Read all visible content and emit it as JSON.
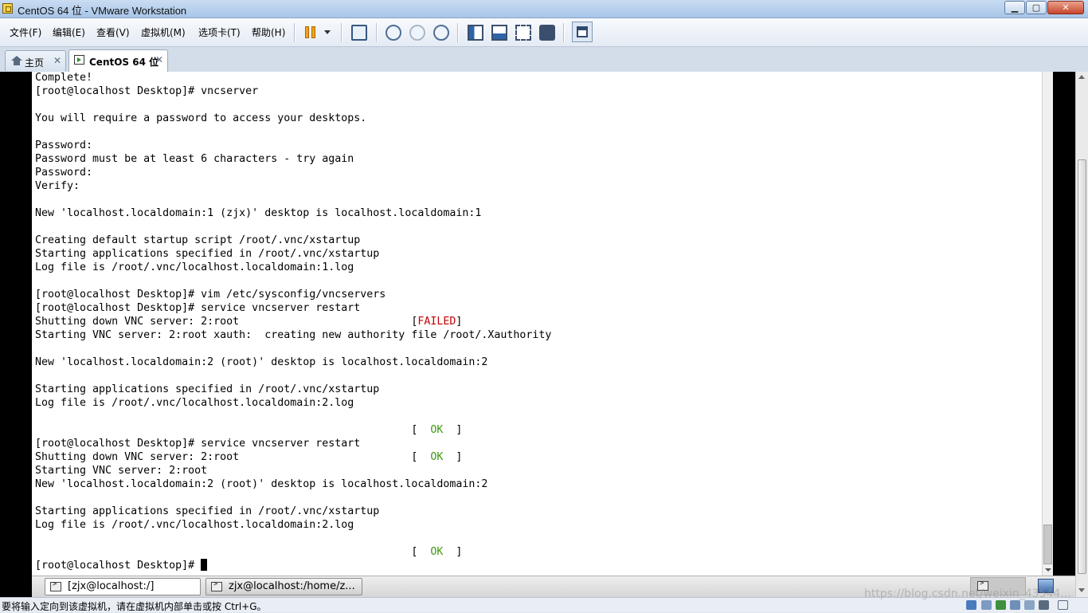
{
  "window": {
    "title": "CentOS 64 位 - VMware Workstation",
    "minimize_glyph": "▁",
    "maximize_glyph": "▢",
    "close_glyph": "✕"
  },
  "menu": {
    "items": [
      "文件(F)",
      "编辑(E)",
      "查看(V)",
      "虚拟机(M)",
      "选项卡(T)",
      "帮助(H)"
    ]
  },
  "toolbar": {
    "icons": [
      "pause-icon",
      "send-ctrl-alt-del-icon",
      "take-snapshot-icon",
      "revert-snapshot-icon",
      "snapshot-manager-icon",
      "console-view-icon",
      "full-screen-icon",
      "stretch-icon",
      "unity-icon",
      "library-icon"
    ],
    "accent_color": "#f0a020"
  },
  "tabs": [
    {
      "label": "主页",
      "close": "✕"
    },
    {
      "label": "CentOS 64 位",
      "close": "✕"
    }
  ],
  "terminal": {
    "lines": [
      {
        "text": "Complete!"
      },
      {
        "text": "[root@localhost Desktop]# vncserver"
      },
      {
        "text": ""
      },
      {
        "text": "You will require a password to access your desktops."
      },
      {
        "text": ""
      },
      {
        "text": "Password:"
      },
      {
        "text": "Password must be at least 6 characters - try again"
      },
      {
        "text": "Password:"
      },
      {
        "text": "Verify:"
      },
      {
        "text": ""
      },
      {
        "text": "New 'localhost.localdomain:1 (zjx)' desktop is localhost.localdomain:1"
      },
      {
        "text": ""
      },
      {
        "text": "Creating default startup script /root/.vnc/xstartup"
      },
      {
        "text": "Starting applications specified in /root/.vnc/xstartup"
      },
      {
        "text": "Log file is /root/.vnc/localhost.localdomain:1.log"
      },
      {
        "text": ""
      },
      {
        "text": "[root@localhost Desktop]# vim /etc/sysconfig/vncservers"
      },
      {
        "text": "[root@localhost Desktop]# service vncserver restart"
      },
      {
        "text": "Shutting down VNC server: 2:root                           ",
        "pre": "[",
        "status": "FAILED",
        "post": "]",
        "status_class": "st-failed"
      },
      {
        "text": "Starting VNC server: 2:root xauth:  creating new authority file /root/.Xauthority"
      },
      {
        "text": ""
      },
      {
        "text": "New 'localhost.localdomain:2 (root)' desktop is localhost.localdomain:2"
      },
      {
        "text": ""
      },
      {
        "text": "Starting applications specified in /root/.vnc/xstartup"
      },
      {
        "text": "Log file is /root/.vnc/localhost.localdomain:2.log"
      },
      {
        "text": ""
      },
      {
        "text": "                                                           ",
        "pre": "[  ",
        "status": "OK",
        "post": "  ]",
        "status_class": "st-ok"
      },
      {
        "text": "[root@localhost Desktop]# service vncserver restart"
      },
      {
        "text": "Shutting down VNC server: 2:root                           ",
        "pre": "[  ",
        "status": "OK",
        "post": "  ]",
        "status_class": "st-ok"
      },
      {
        "text": "Starting VNC server: 2:root"
      },
      {
        "text": "New 'localhost.localdomain:2 (root)' desktop is localhost.localdomain:2"
      },
      {
        "text": ""
      },
      {
        "text": "Starting applications specified in /root/.vnc/xstartup"
      },
      {
        "text": "Log file is /root/.vnc/localhost.localdomain:2.log"
      },
      {
        "text": ""
      },
      {
        "text": "                                                           ",
        "pre": "[  ",
        "status": "OK",
        "post": "  ]",
        "status_class": "st-ok"
      },
      {
        "text": "[root@localhost Desktop]# ",
        "cursor": true
      }
    ],
    "colors": {
      "failed": "#c00000",
      "ok": "#3c9a0e"
    }
  },
  "guest_taskbar": {
    "buttons": [
      {
        "label": "[zjx@localhost:/]"
      },
      {
        "label": "zjx@localhost:/home/z..."
      }
    ]
  },
  "statusbar": {
    "text": "要将输入定向到该虚拟机，请在虚拟机内部单击或按 Ctrl+G。",
    "watermark": "https://blog.csdn.net/weixin_43544..."
  }
}
